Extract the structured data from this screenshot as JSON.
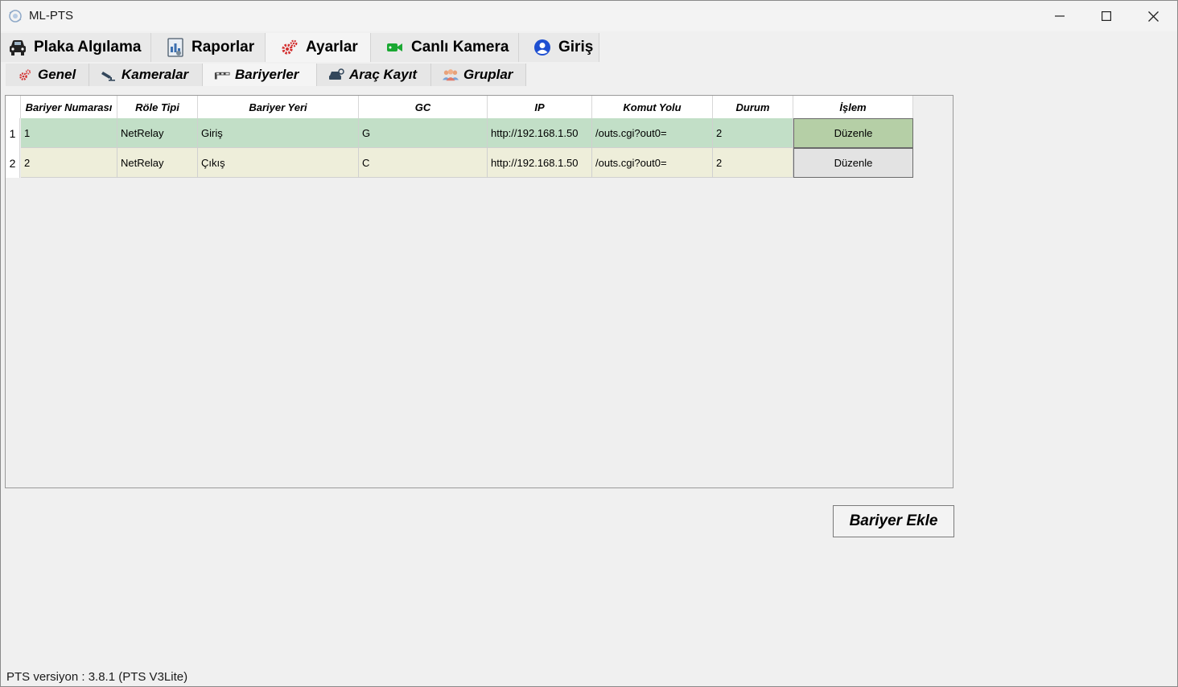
{
  "window": {
    "title": "ML-PTS",
    "minimize_icon": "minimize-icon",
    "maximize_icon": "maximize-icon",
    "close_icon": "close-icon"
  },
  "main_tabs": [
    {
      "label": "Plaka Algılama",
      "icon": "car-icon",
      "active": false
    },
    {
      "label": "Raporlar",
      "icon": "report-icon",
      "active": false
    },
    {
      "label": "Ayarlar",
      "icon": "gears-icon",
      "active": true
    },
    {
      "label": "Canlı Kamera",
      "icon": "video-camera-icon",
      "active": false
    },
    {
      "label": "Giriş",
      "icon": "user-icon",
      "active": false
    }
  ],
  "sub_tabs": [
    {
      "label": "Genel",
      "icon": "gears-icon",
      "active": false
    },
    {
      "label": "Kameralar",
      "icon": "security-camera-icon",
      "active": false
    },
    {
      "label": "Bariyerler",
      "icon": "barrier-icon",
      "active": true
    },
    {
      "label": "Araç Kayıt",
      "icon": "car-key-icon",
      "active": false
    },
    {
      "label": "Gruplar",
      "icon": "group-icon",
      "active": false
    }
  ],
  "table": {
    "columns": [
      "Bariyer Numarası",
      "Röle Tipi",
      "Bariyer Yeri",
      "GC",
      "IP",
      "Komut Yolu",
      "Durum",
      "İşlem"
    ],
    "rows": [
      {
        "index": "1",
        "cells": [
          "1",
          "NetRelay",
          "Giriş",
          "G",
          "http://192.168.1.50",
          "/outs.cgi?out0=",
          "2"
        ],
        "action": "Düzenle",
        "row_color": "#c2dfc7"
      },
      {
        "index": "2",
        "cells": [
          "2",
          "NetRelay",
          "Çıkış",
          "C",
          "http://192.168.1.50",
          "/outs.cgi?out0=",
          "2"
        ],
        "action": "Düzenle",
        "row_color": "#eeeeda"
      }
    ]
  },
  "add_button_label": "Bariyer Ekle",
  "status_text": "PTS versiyon : 3.8.1 (PTS V3Lite)",
  "colors": {
    "accent_red": "#d32f2f",
    "accent_blue": "#1e4fd1",
    "accent_green": "#1aa832"
  }
}
